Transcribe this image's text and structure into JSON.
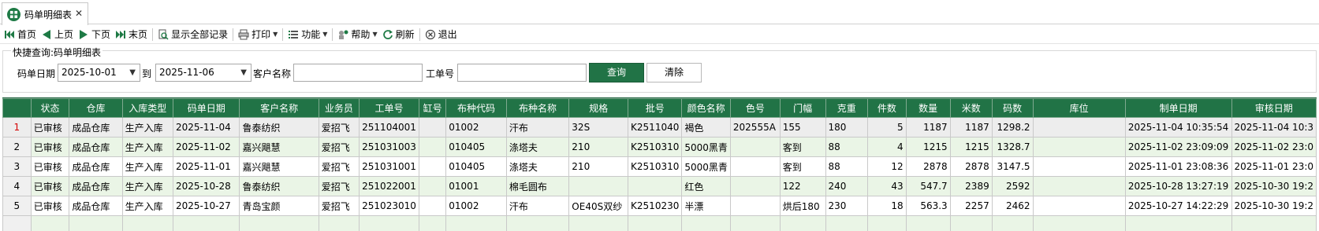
{
  "tab": {
    "title": "码单明细表",
    "close": "✕"
  },
  "toolbar": {
    "first": "首页",
    "prev": "上页",
    "next": "下页",
    "last": "末页",
    "show_all": "显示全部记录",
    "print": "打印",
    "functions": "功能",
    "help": "帮助",
    "refresh": "刷新",
    "exit": "退出"
  },
  "query": {
    "legend": "快捷查询:码单明细表",
    "date_label": "码单日期",
    "date_from": "2025-10-01",
    "to_label": "到",
    "date_to": "2025-11-06",
    "customer_label": "客户名称",
    "customer_value": "",
    "order_label": "工单号",
    "order_value": "",
    "query_button": "查询",
    "clear_button": "清除"
  },
  "grid": {
    "columns": [
      "状态",
      "仓库",
      "入库类型",
      "码单日期",
      "客户名称",
      "业务员",
      "工单号",
      "缸号",
      "布种代码",
      "布种名称",
      "规格",
      "批号",
      "颜色名称",
      "色号",
      "门幅",
      "克重",
      "件数",
      "数量",
      "米数",
      "码数",
      "库位",
      "制单日期",
      "审核日期"
    ],
    "rows": [
      {
        "n": "1",
        "cells": [
          "已审核",
          "成品仓库",
          "生产入库",
          "2025-11-04",
          "鲁泰纺织",
          "爱招飞",
          "251104001",
          "",
          "01002",
          "汗布",
          "32S",
          "K2511040",
          "褐色",
          "202555A",
          "155",
          "180",
          "5",
          "1187",
          "1187",
          "1298.2",
          "",
          "2025-11-04 10:35:54",
          "2025-11-04 10:3"
        ]
      },
      {
        "n": "2",
        "cells": [
          "已审核",
          "成品仓库",
          "生产入库",
          "2025-11-02",
          "嘉兴飓慧",
          "爱招飞",
          "251031003",
          "",
          "010405",
          "涤塔夫",
          "210",
          "K2510310",
          "5000黑青",
          "",
          "客到",
          "88",
          "4",
          "1215",
          "1215",
          "1328.7",
          "",
          "2025-11-02 23:09:09",
          "2025-11-02 23:0"
        ]
      },
      {
        "n": "3",
        "cells": [
          "已审核",
          "成品仓库",
          "生产入库",
          "2025-11-01",
          "嘉兴飓慧",
          "爱招飞",
          "251031001",
          "",
          "010405",
          "涤塔夫",
          "210",
          "K2510310",
          "5000黑青",
          "",
          "客到",
          "88",
          "12",
          "2878",
          "2878",
          "3147.5",
          "",
          "2025-11-01 23:08:36",
          "2025-11-01 23:0"
        ]
      },
      {
        "n": "4",
        "cells": [
          "已审核",
          "成品仓库",
          "生产入库",
          "2025-10-28",
          "鲁泰纺织",
          "爱招飞",
          "251022001",
          "",
          "01001",
          "棉毛圆布",
          "",
          "",
          "红色",
          "",
          "122",
          "240",
          "43",
          "547.7",
          "2389",
          "2592",
          "",
          "2025-10-28 13:27:19",
          "2025-10-30 19:2"
        ]
      },
      {
        "n": "5",
        "cells": [
          "已审核",
          "成品仓库",
          "生产入库",
          "2025-10-27",
          "青岛宝颜",
          "爱招飞",
          "251023010",
          "",
          "01002",
          "汗布",
          "OE40S双纱",
          "K2510230",
          "半漂",
          "",
          "烘后180",
          "230",
          "18",
          "563.3",
          "2257",
          "2462",
          "",
          "2025-10-27 14:22:29",
          "2025-10-30 19:2"
        ]
      },
      {
        "n": "",
        "cells": [
          "",
          "",
          "",
          "",
          "",
          "",
          "",
          "",
          "",
          "",
          "",
          "",
          "",
          "",
          "",
          "",
          "",
          "",
          "",
          "",
          "",
          "",
          ""
        ]
      }
    ]
  }
}
